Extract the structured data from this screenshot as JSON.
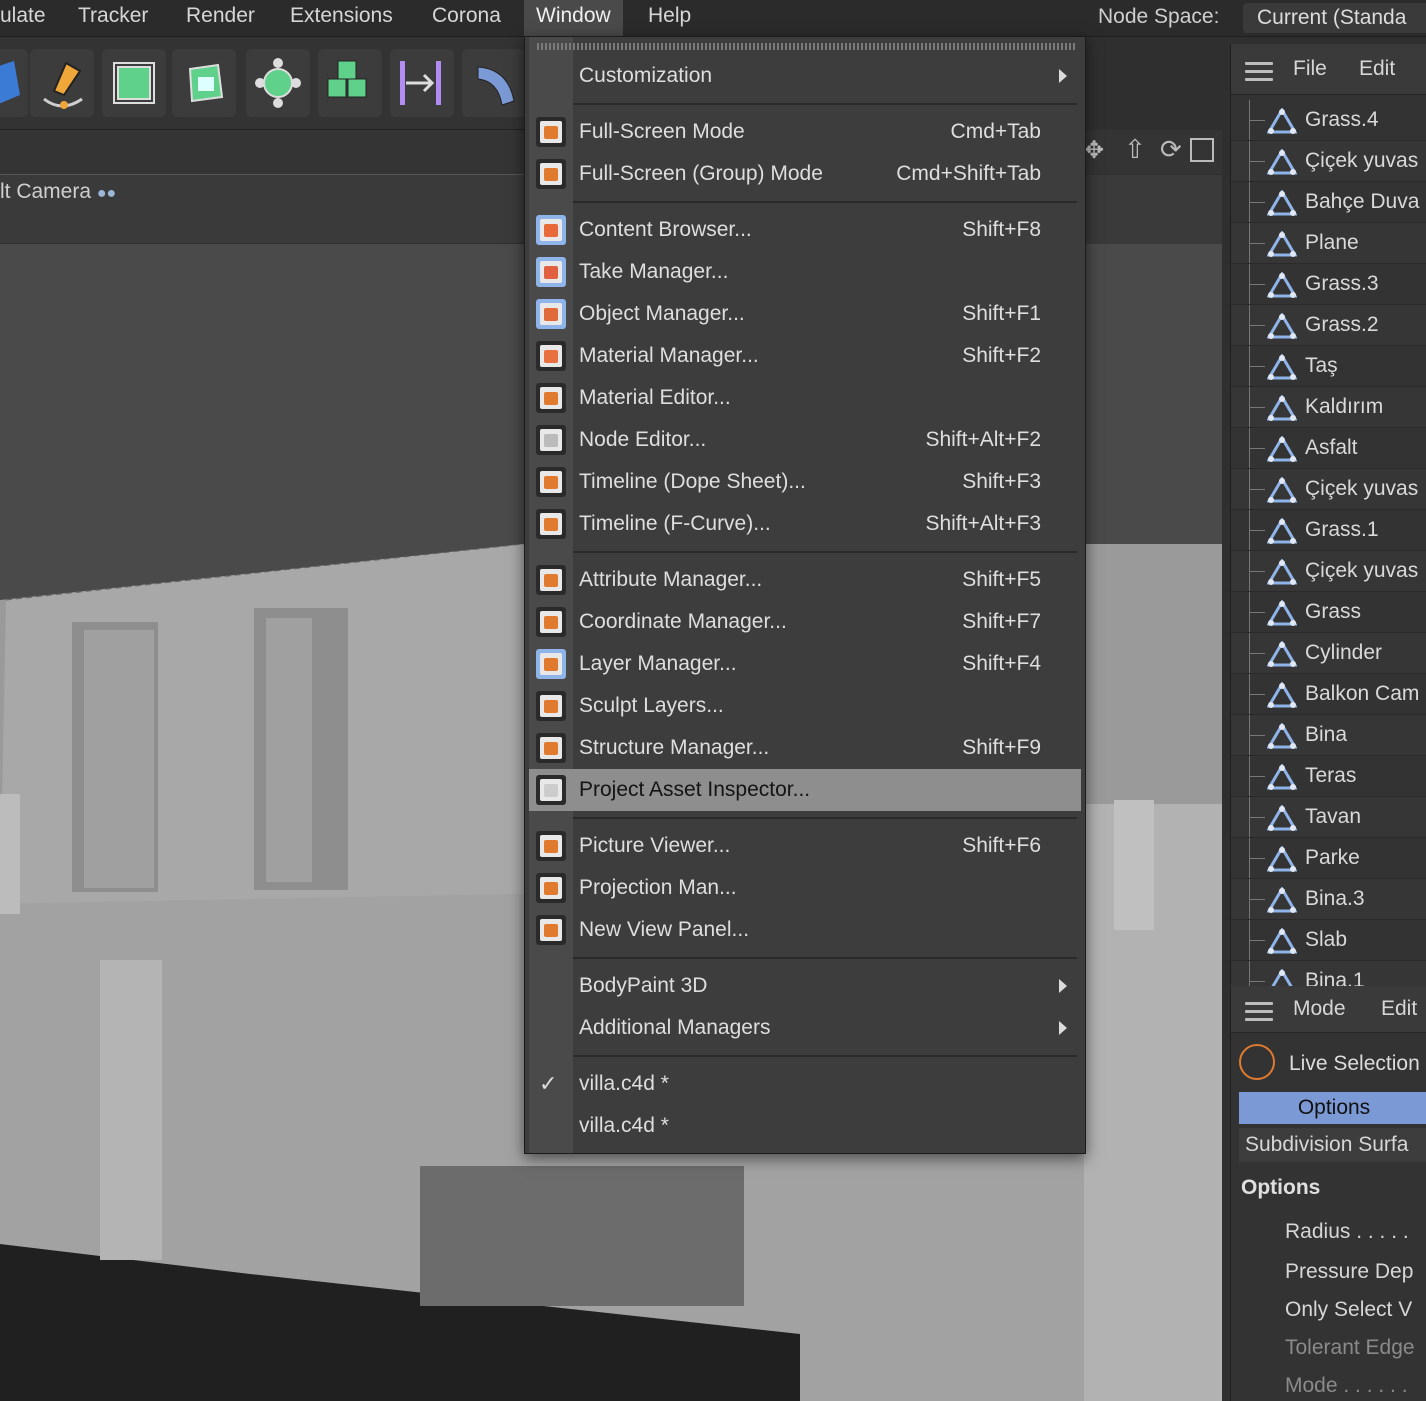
{
  "menubar": {
    "items": [
      "ulate",
      "Tracker",
      "Render",
      "Extensions",
      "Corona",
      "Window",
      "Help"
    ],
    "active": "Window",
    "node_space_label": "Node Space:",
    "node_space_value": "Current (Standa"
  },
  "viewport": {
    "camera_label": "lt Camera"
  },
  "window_menu": {
    "items": [
      {
        "label": "Customization",
        "shortcut": "",
        "submenu": true
      },
      {
        "label": "Full-Screen Mode",
        "shortcut": "Cmd+Tab"
      },
      {
        "label": "Full-Screen (Group) Mode",
        "shortcut": "Cmd+Shift+Tab"
      },
      {
        "label": "Content Browser...",
        "shortcut": "Shift+F8"
      },
      {
        "label": "Take Manager...",
        "shortcut": ""
      },
      {
        "label": "Object Manager...",
        "shortcut": "Shift+F1"
      },
      {
        "label": "Material Manager...",
        "shortcut": "Shift+F2"
      },
      {
        "label": "Material Editor...",
        "shortcut": ""
      },
      {
        "label": "Node Editor...",
        "shortcut": "Shift+Alt+F2"
      },
      {
        "label": "Timeline (Dope Sheet)...",
        "shortcut": "Shift+F3"
      },
      {
        "label": "Timeline (F-Curve)...",
        "shortcut": "Shift+Alt+F3"
      },
      {
        "label": "Attribute Manager...",
        "shortcut": "Shift+F5"
      },
      {
        "label": "Coordinate Manager...",
        "shortcut": "Shift+F7"
      },
      {
        "label": "Layer Manager...",
        "shortcut": "Shift+F4"
      },
      {
        "label": "Sculpt Layers...",
        "shortcut": ""
      },
      {
        "label": "Structure Manager...",
        "shortcut": "Shift+F9"
      },
      {
        "label": "Project Asset Inspector...",
        "shortcut": "",
        "highlighted": true
      },
      {
        "label": "Picture Viewer...",
        "shortcut": "Shift+F6"
      },
      {
        "label": "Projection Man...",
        "shortcut": ""
      },
      {
        "label": "New View Panel...",
        "shortcut": ""
      },
      {
        "label": "BodyPaint 3D",
        "shortcut": "",
        "submenu": true
      },
      {
        "label": "Additional Managers",
        "shortcut": "",
        "submenu": true
      },
      {
        "label": "villa.c4d *",
        "shortcut": "",
        "checked": true
      },
      {
        "label": "villa.c4d *",
        "shortcut": ""
      }
    ]
  },
  "object_manager": {
    "menu": [
      "File",
      "Edit"
    ],
    "objects": [
      "Grass.4",
      "Çiçek yuvas",
      "Bahçe Duva",
      "Plane",
      "Grass.3",
      "Grass.2",
      "Taş",
      "Kaldırım",
      "Asfalt",
      "Çiçek yuvas",
      "Grass.1",
      "Çiçek yuvas",
      "Grass",
      "Cylinder",
      "Balkon Cam",
      "Bina",
      "Teras",
      "Tavan",
      "Parke",
      "Bina.3",
      "Slab",
      "Bina.1"
    ]
  },
  "attribute_manager": {
    "menu": [
      "Mode",
      "Edit"
    ],
    "tool": "Live Selection",
    "tab_active": "Options",
    "tab_other": "Subdivision Surfa",
    "section": "Options",
    "rows": [
      "Radius . . . . .",
      "Pressure Dep",
      "Only Select V",
      "Tolerant Edge",
      "Mode . . . . . ."
    ]
  },
  "colors": {
    "menu_bg": "#3d3d3d",
    "highlight": "#8e8e8e",
    "accent_blue": "#7b99d4",
    "accent_orange": "#e07a2f"
  }
}
